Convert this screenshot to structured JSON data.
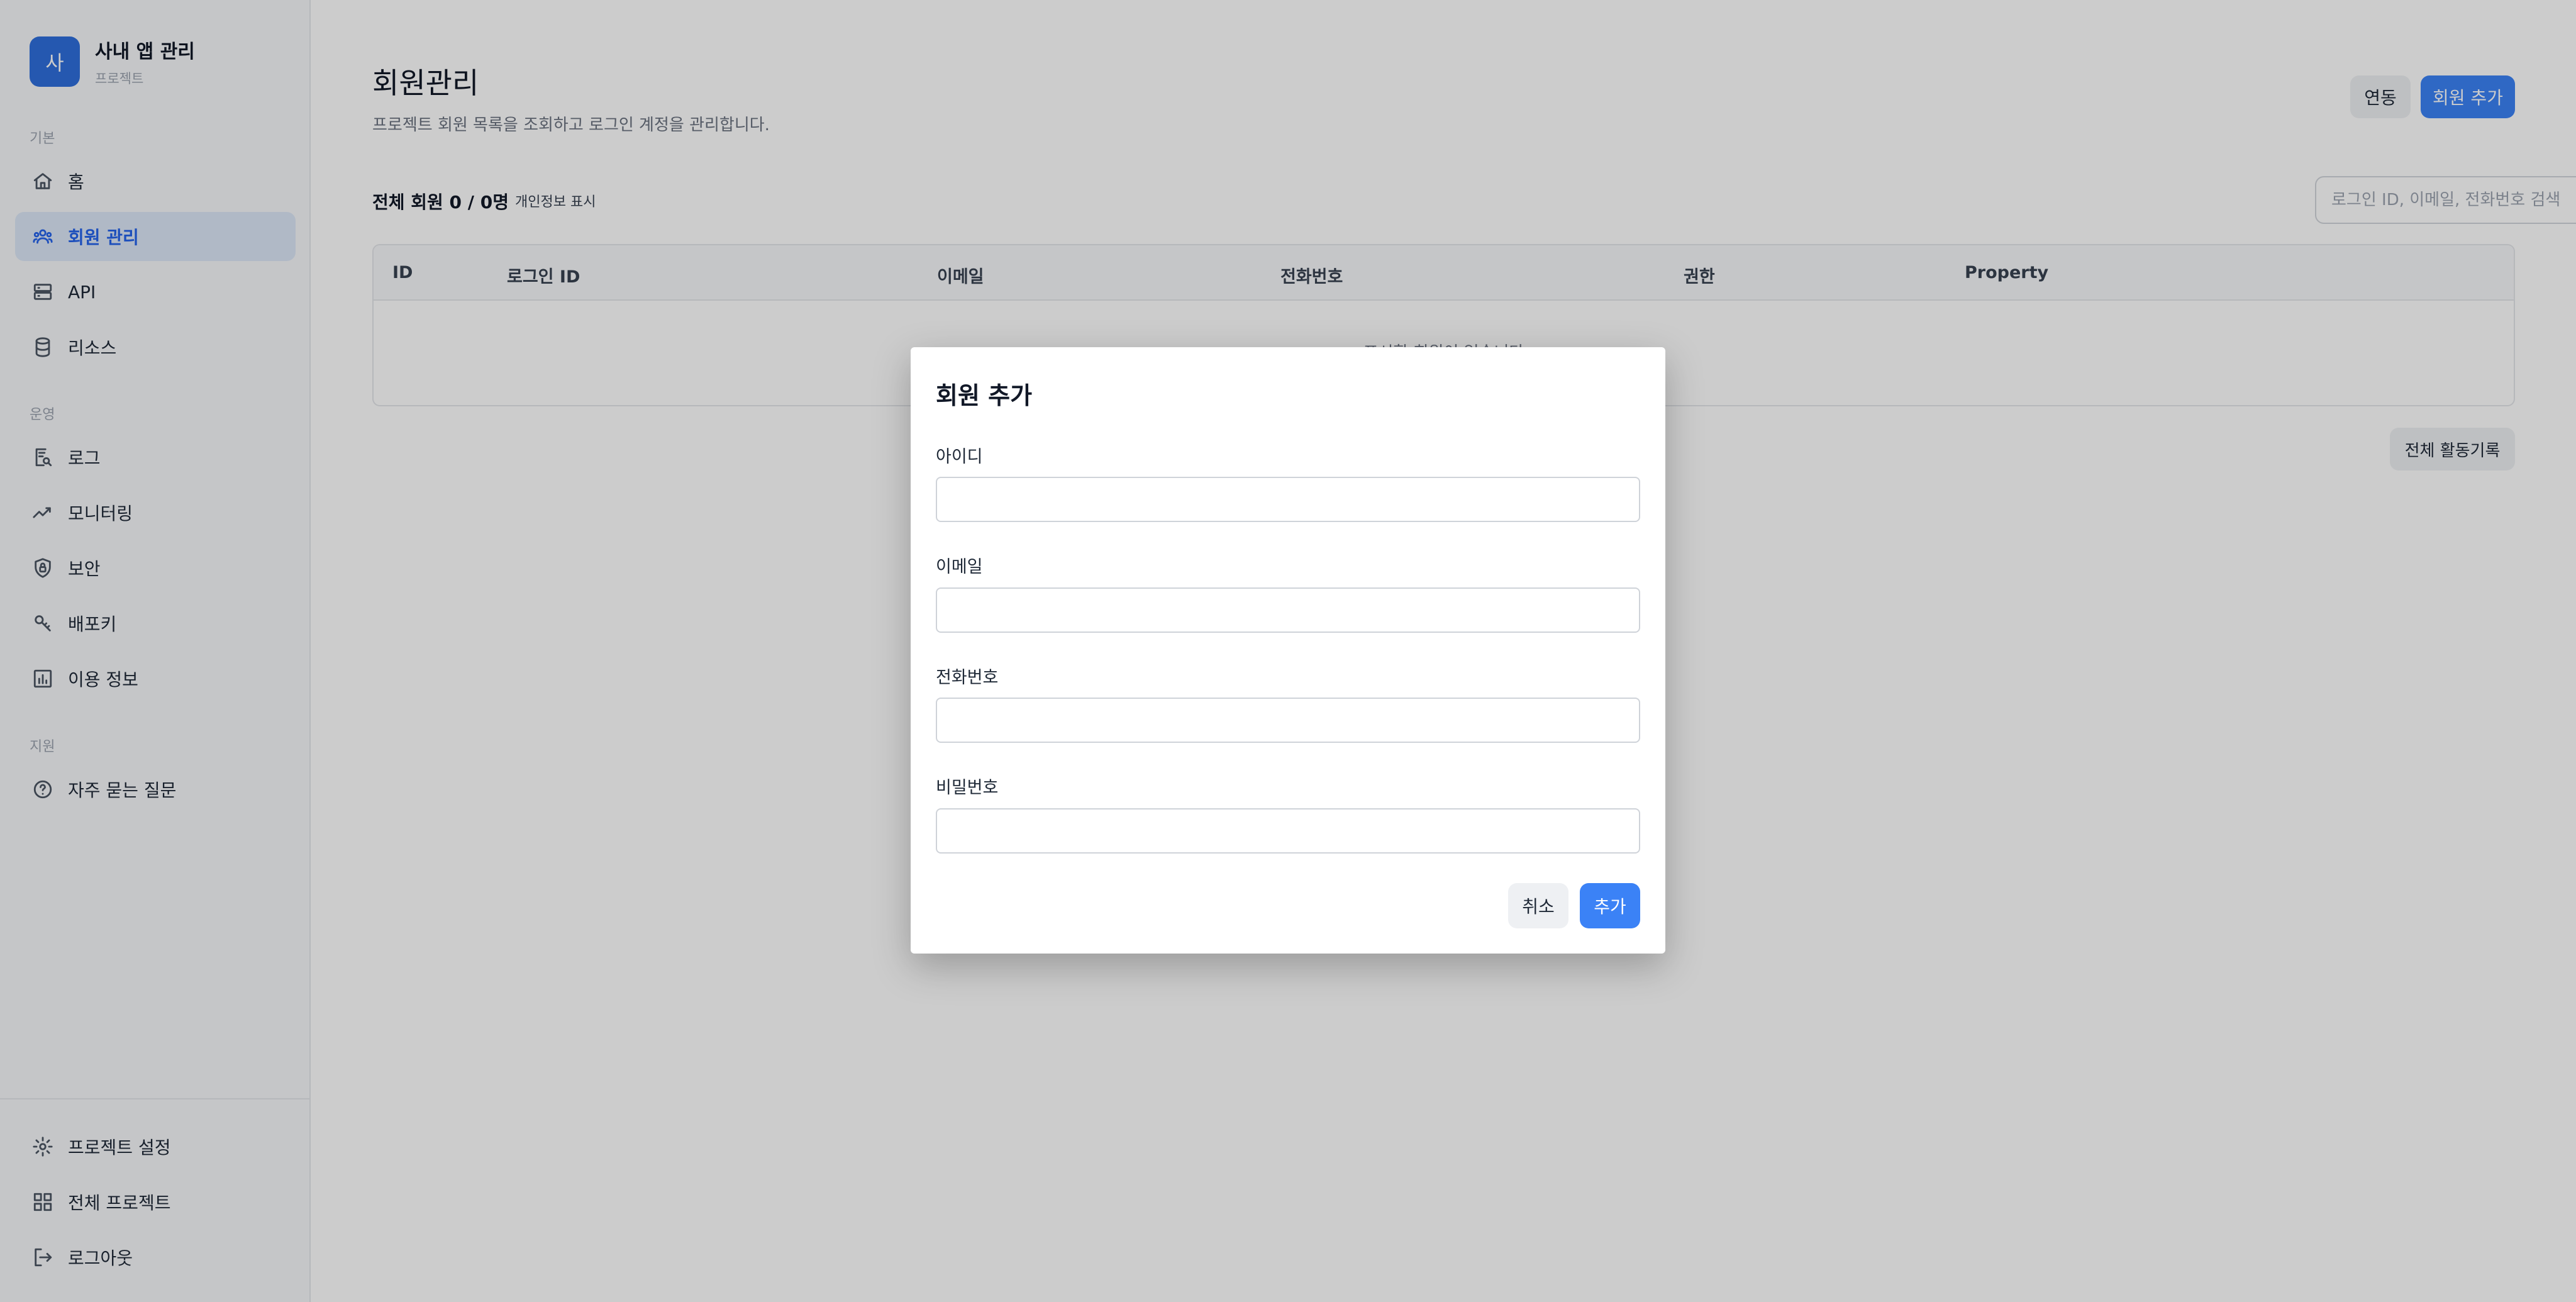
{
  "brand": {
    "logo_letter": "사",
    "title": "사내 앱 관리",
    "subtitle": "프로젝트"
  },
  "sidebar": {
    "sections": [
      "기본",
      "운영",
      "지원"
    ],
    "items": [
      {
        "label": "홈",
        "icon": "home-icon"
      },
      {
        "label": "회원 관리",
        "icon": "users-icon",
        "active": true
      },
      {
        "label": "API",
        "icon": "server-icon"
      },
      {
        "label": "리소스",
        "icon": "database-icon"
      },
      {
        "label": "로그",
        "icon": "log-search-icon"
      },
      {
        "label": "모니터링",
        "icon": "trend-icon"
      },
      {
        "label": "보안",
        "icon": "shield-icon"
      },
      {
        "label": "배포키",
        "icon": "key-icon"
      },
      {
        "label": "이용 정보",
        "icon": "bar-chart-icon"
      },
      {
        "label": "자주 묻는 질문",
        "icon": "help-circle-icon"
      }
    ],
    "bottom_items": [
      {
        "label": "프로젝트 설정",
        "icon": "gear-icon"
      },
      {
        "label": "전체 프로젝트",
        "icon": "grid-icon"
      },
      {
        "label": "로그아웃",
        "icon": "logout-icon"
      }
    ]
  },
  "main": {
    "title": "회원관리",
    "description": "프로젝트 회원 목록을 조회하고 로그인 계정을 관리합니다.",
    "link_button": "연동",
    "add_member_button": "회원 추가",
    "member_count": "전체 회원 0 / 0명",
    "privacy_toggle": "개인정보 표시",
    "search_placeholder": "로그인 ID, 이메일, 전화번호 검색",
    "table_headers": [
      "ID",
      "로그인 ID",
      "이메일",
      "전화번호",
      "권한",
      "Property"
    ],
    "empty_text": "표시할 회원이 없습니다",
    "activity_log_button": "전체 활동기록"
  },
  "modal": {
    "title": "회원 추가",
    "fields": [
      {
        "label": "아이디",
        "value": ""
      },
      {
        "label": "이메일",
        "value": ""
      },
      {
        "label": "전화번호",
        "value": ""
      },
      {
        "label": "비밀번호",
        "value": ""
      }
    ],
    "cancel_button": "취소",
    "submit_button": "추가"
  },
  "colors": {
    "accent": "#3b82f6",
    "brand": "#2f6fdc",
    "active_bg": "#dde8f8",
    "overlay": "rgba(0,0,0,0.2)"
  }
}
